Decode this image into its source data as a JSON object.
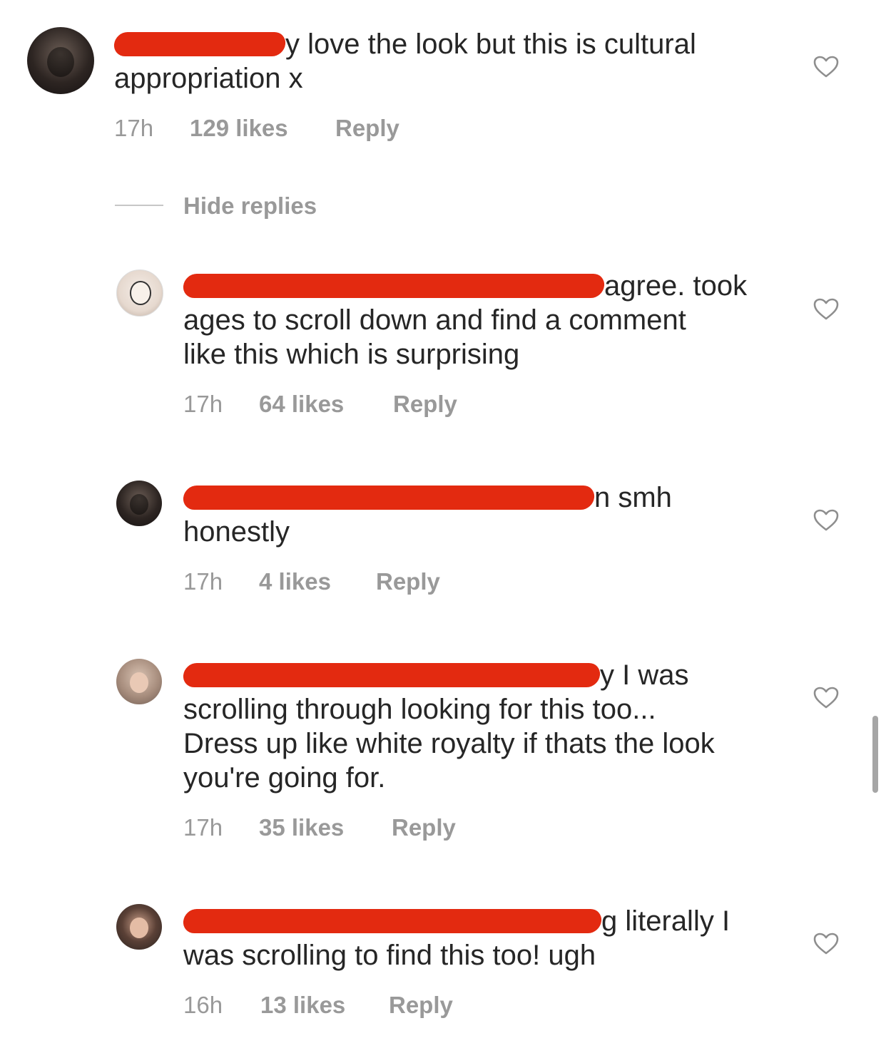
{
  "comments": [
    {
      "text_line1": "y love the look but this is cultural",
      "text_line2": "appropriation x",
      "time": "17h",
      "likes": "129 likes",
      "reply": "Reply"
    }
  ],
  "hide_replies": "Hide replies",
  "replies": [
    {
      "text_line1": "agree. took",
      "text_line2": "ages to scroll down and find a comment",
      "text_line3": "like this which is surprising",
      "time": "17h",
      "likes": "64 likes",
      "reply": "Reply"
    },
    {
      "text_line1": "n smh",
      "text_line2": "honestly",
      "time": "17h",
      "likes": "4 likes",
      "reply": "Reply"
    },
    {
      "text_line1": "y I was",
      "text_line2": "scrolling through looking for this too...",
      "text_line3": "Dress up like white royalty if thats the look",
      "text_line4": "you're going for.",
      "time": "17h",
      "likes": "35 likes",
      "reply": "Reply"
    },
    {
      "text_line1": "g literally I",
      "text_line2": "was scrolling to find this too! ugh",
      "time": "16h",
      "likes": "13 likes",
      "reply": "Reply"
    }
  ],
  "colors": {
    "redaction": "#e32a10",
    "meta_gray": "#999999",
    "text": "#262626"
  },
  "icons": {
    "like": "heart-outline-icon"
  }
}
